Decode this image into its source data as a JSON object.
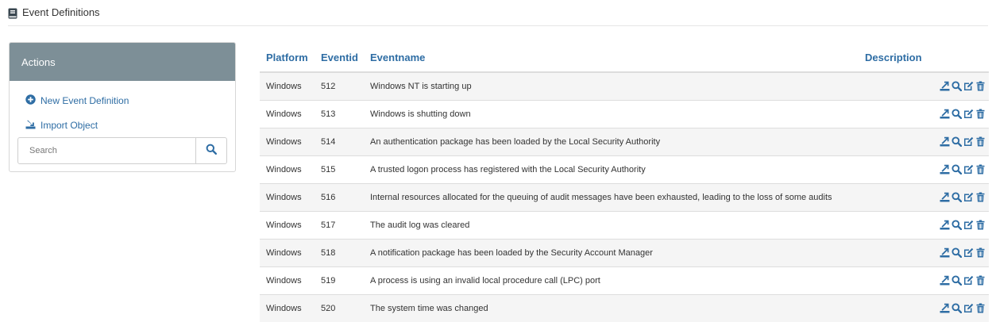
{
  "page": {
    "title": "Event Definitions"
  },
  "actions": {
    "header": "Actions",
    "new_label": "New Event Definition",
    "import_label": "Import Object",
    "search_placeholder": "Search"
  },
  "table": {
    "columns": [
      "Platform",
      "Eventid",
      "Eventname",
      "Description"
    ],
    "rows": [
      {
        "platform": "Windows",
        "eventid": "512",
        "eventname": "Windows NT is starting up",
        "description": ""
      },
      {
        "platform": "Windows",
        "eventid": "513",
        "eventname": "Windows is shutting down",
        "description": ""
      },
      {
        "platform": "Windows",
        "eventid": "514",
        "eventname": "An authentication package has been loaded by the Local Security Authority",
        "description": ""
      },
      {
        "platform": "Windows",
        "eventid": "515",
        "eventname": "A trusted logon process has registered with the Local Security Authority",
        "description": ""
      },
      {
        "platform": "Windows",
        "eventid": "516",
        "eventname": "Internal resources allocated for the queuing of audit messages have been exhausted, leading to the loss of some audits",
        "description": ""
      },
      {
        "platform": "Windows",
        "eventid": "517",
        "eventname": "The audit log was cleared",
        "description": ""
      },
      {
        "platform": "Windows",
        "eventid": "518",
        "eventname": "A notification package has been loaded by the Security Account Manager",
        "description": ""
      },
      {
        "platform": "Windows",
        "eventid": "519",
        "eventname": "A process is using an invalid local procedure call (LPC) port",
        "description": ""
      },
      {
        "platform": "Windows",
        "eventid": "520",
        "eventname": "The system time was changed",
        "description": ""
      }
    ],
    "row_actions": [
      "export-icon",
      "search-icon",
      "edit-icon",
      "trash-icon"
    ]
  },
  "colors": {
    "accent": "#2e6da4",
    "panel_header": "#7d8f97",
    "row_stripe": "#f5f5f5"
  }
}
